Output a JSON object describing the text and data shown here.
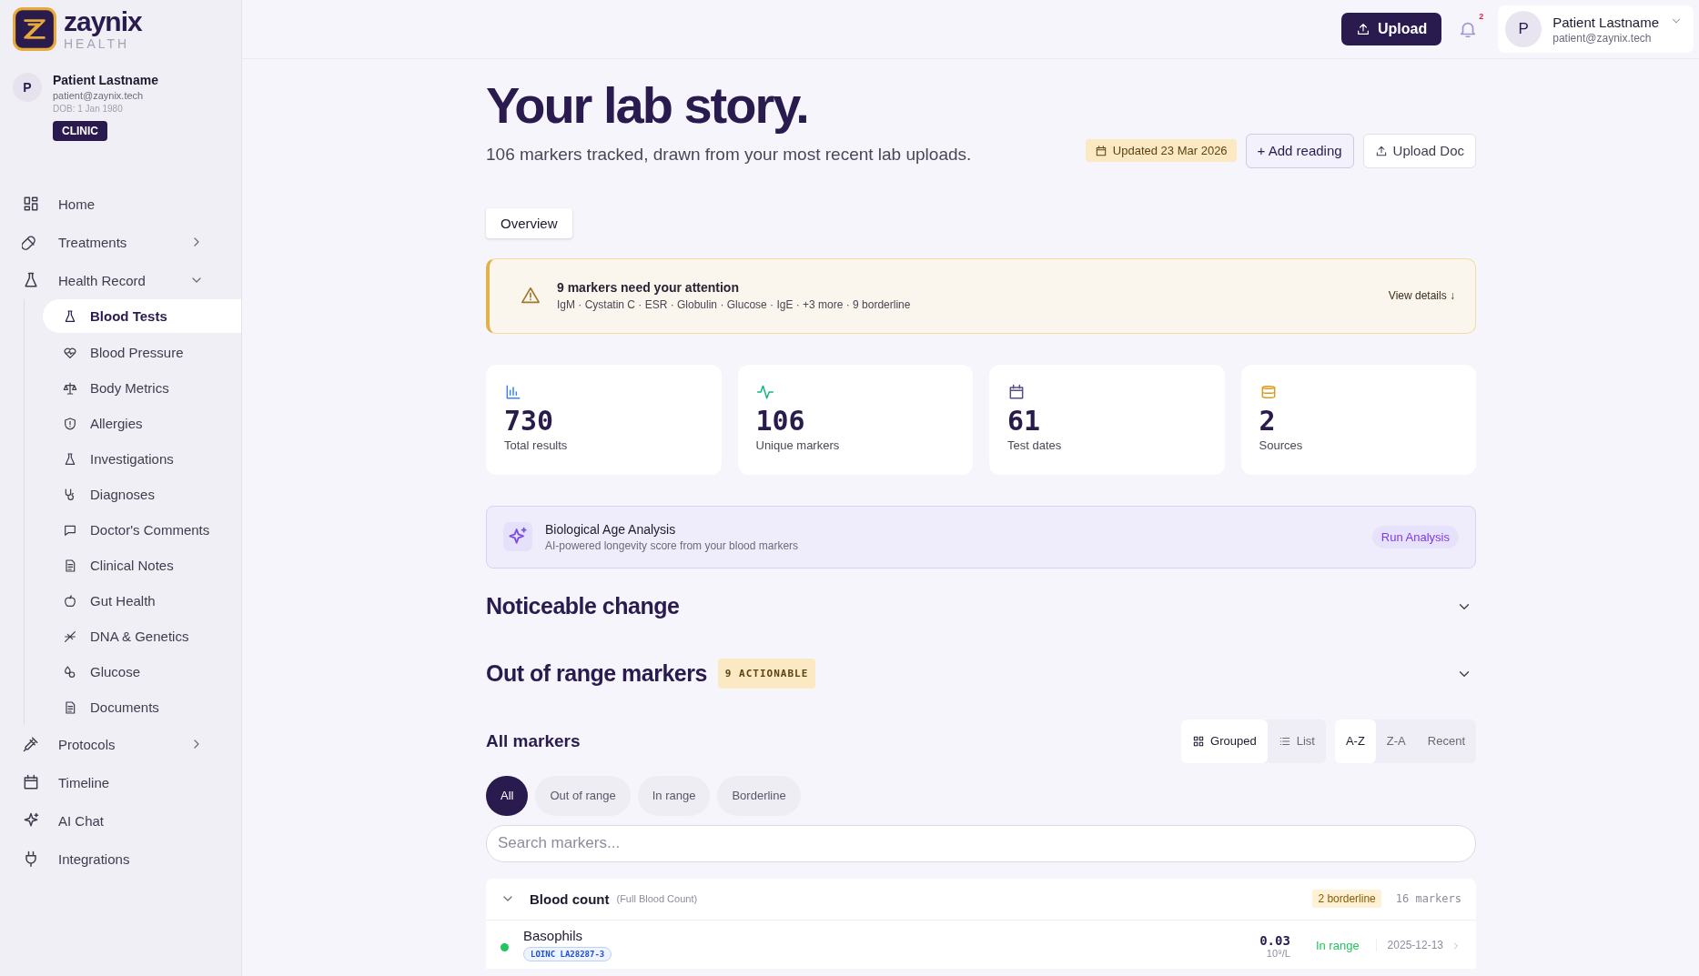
{
  "brand": {
    "name": "zaynix",
    "sub": "HEALTH"
  },
  "profile": {
    "initial": "P",
    "name": "Patient Lastname",
    "email": "patient@zaynix.tech",
    "dob": "DOB: 1 Jan 1980",
    "badge": "CLINIC"
  },
  "nav": [
    {
      "label": "Home",
      "selected": false
    },
    {
      "label": "Treatments",
      "selected": false,
      "expanded": false
    },
    {
      "label": "Health Record",
      "selected": false,
      "expanded": true,
      "children": [
        {
          "label": "Blood Tests",
          "selected": true
        },
        {
          "label": "Blood Pressure",
          "selected": false
        },
        {
          "label": "Body Metrics",
          "selected": false
        },
        {
          "label": "Allergies",
          "selected": false
        },
        {
          "label": "Investigations",
          "selected": false
        },
        {
          "label": "Diagnoses",
          "selected": false
        },
        {
          "label": "Doctor's Comments",
          "selected": false
        },
        {
          "label": "Clinical Notes",
          "selected": false
        },
        {
          "label": "Gut Health",
          "selected": false
        },
        {
          "label": "DNA & Genetics",
          "selected": false
        },
        {
          "label": "Glucose",
          "selected": false
        },
        {
          "label": "Documents",
          "selected": false
        }
      ]
    },
    {
      "label": "Protocols",
      "selected": false,
      "expanded": false
    },
    {
      "label": "Timeline",
      "selected": false
    },
    {
      "label": "AI Chat",
      "selected": false
    },
    {
      "label": "Integrations",
      "selected": false
    }
  ],
  "topbar": {
    "upload": "Upload",
    "notifications": "2",
    "user": {
      "initial": "P",
      "name": "Patient Lastname",
      "email": "patient@zaynix.tech"
    }
  },
  "header": {
    "title": "Your lab story.",
    "subtitle": "106 markers tracked, drawn from your most recent lab uploads.",
    "updated": "Updated 23 Mar 2026",
    "add": "+ Add reading",
    "upload_doc": "Upload Doc"
  },
  "tabs": [
    {
      "label": "Overview",
      "selected": true
    }
  ],
  "alert": {
    "title": "9 markers need your attention",
    "detail": "IgM · Cystatin C · ESR · Globulin · Glucose · IgE · +3 more · 9 borderline",
    "link": "View details ↓"
  },
  "stats": [
    {
      "value": "730",
      "label": "Total results",
      "color": "#3b82f6"
    },
    {
      "value": "106",
      "label": "Unique markers",
      "color": "#10b981"
    },
    {
      "value": "61",
      "label": "Test dates",
      "color": "#5b4b8a"
    },
    {
      "value": "2",
      "label": "Sources",
      "color": "#d99a1e"
    }
  ],
  "bio": {
    "title": "Biological Age Analysis",
    "subtitle": "AI-powered longevity score from your blood markers",
    "action": "Run Analysis"
  },
  "sections": [
    {
      "title": "Noticeable change",
      "expanded": false
    },
    {
      "title": "Out of range markers",
      "badge": "9 ACTIONABLE",
      "expanded": false
    }
  ],
  "all_markers": {
    "title": "All markers",
    "views": [
      {
        "label": "Grouped",
        "selected": true
      },
      {
        "label": "List",
        "selected": false
      }
    ],
    "sorts": [
      {
        "label": "A-Z",
        "selected": true
      },
      {
        "label": "Z-A",
        "selected": false
      },
      {
        "label": "Recent",
        "selected": false
      }
    ],
    "filters": [
      {
        "label": "All",
        "selected": true
      },
      {
        "label": "Out of range",
        "selected": false
      },
      {
        "label": "In range",
        "selected": false
      },
      {
        "label": "Borderline",
        "selected": false
      }
    ],
    "search": {
      "placeholder": "Search markers..."
    },
    "groups": [
      {
        "name": "Blood count",
        "subtitle": "(Full Blood Count)",
        "expanded": true,
        "flag": "2 borderline",
        "count": "16 markers",
        "rows": [
          {
            "name": "Basophils",
            "code": "LOINC LA28287-3",
            "value": "0.03",
            "unit": "10⁹/L",
            "status": "In range",
            "color": "#22c55e",
            "date": "2025-12-13"
          }
        ]
      }
    ]
  }
}
